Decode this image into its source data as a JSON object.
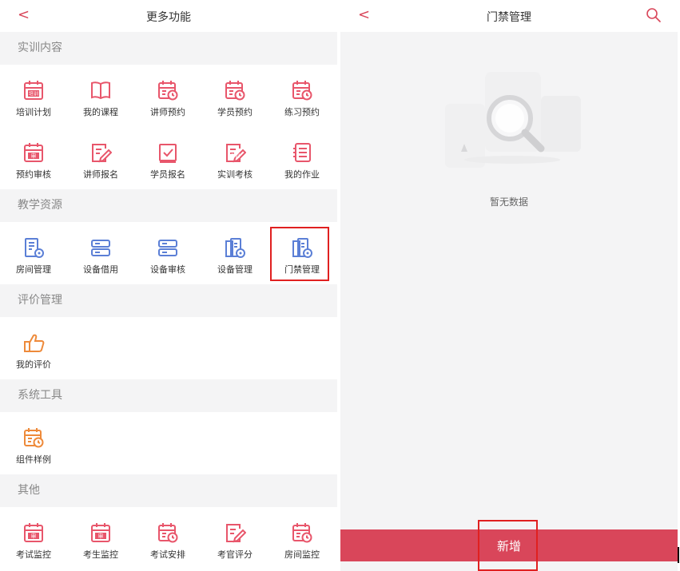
{
  "left": {
    "header": {
      "back": "<",
      "title": "更多功能"
    },
    "sections": [
      {
        "title": "实训内容",
        "items": [
          {
            "label": "培训计划",
            "icon": "training-plan-icon",
            "badge": "培训",
            "color": "#e8566b"
          },
          {
            "label": "我的课程",
            "icon": "book-icon",
            "color": "#e8566b"
          },
          {
            "label": "讲师预约",
            "icon": "calendar-clock-icon",
            "color": "#e8566b"
          },
          {
            "label": "学员预约",
            "icon": "calendar-clock-icon",
            "color": "#e8566b"
          },
          {
            "label": "练习预约",
            "icon": "calendar-clock-icon",
            "color": "#e8566b"
          },
          {
            "label": "预约审核",
            "icon": "calendar-approve-icon",
            "badge": "审",
            "color": "#e8566b"
          },
          {
            "label": "讲师报名",
            "icon": "edit-document-icon",
            "color": "#e8566b"
          },
          {
            "label": "学员报名",
            "icon": "check-box-icon",
            "color": "#e8566b"
          },
          {
            "label": "实训考核",
            "icon": "edit-document-icon",
            "badge": "实训",
            "color": "#e8566b"
          },
          {
            "label": "我的作业",
            "icon": "list-document-icon",
            "color": "#e8566b"
          }
        ]
      },
      {
        "title": "教学资源",
        "items": [
          {
            "label": "房间管理",
            "icon": "building-gear-icon",
            "color": "#5b7fd6"
          },
          {
            "label": "设备借用",
            "icon": "server-icon",
            "color": "#5b7fd6"
          },
          {
            "label": "设备审核",
            "icon": "server-icon",
            "color": "#5b7fd6"
          },
          {
            "label": "设备管理",
            "icon": "door-gear-icon",
            "color": "#5b7fd6"
          },
          {
            "label": "门禁管理",
            "icon": "door-gear-icon",
            "color": "#5b7fd6",
            "highlight": true
          }
        ]
      },
      {
        "title": "评价管理",
        "items": [
          {
            "label": "我的评价",
            "icon": "thumbs-up-icon",
            "color": "#ee8a3a"
          }
        ]
      },
      {
        "title": "系统工具",
        "items": [
          {
            "label": "组件样例",
            "icon": "calendar-clock-icon",
            "color": "#ee8a3a"
          }
        ]
      },
      {
        "title": "其他",
        "items": [
          {
            "label": "考试监控",
            "icon": "calendar-approve-icon",
            "badge": "审",
            "color": "#e8566b"
          },
          {
            "label": "考生监控",
            "icon": "calendar-approve-icon",
            "badge": "审",
            "color": "#e8566b"
          },
          {
            "label": "考试安排",
            "icon": "calendar-clock-icon",
            "color": "#e8566b"
          },
          {
            "label": "考官评分",
            "icon": "edit-document-icon",
            "color": "#e8566b"
          },
          {
            "label": "房间监控",
            "icon": "calendar-clock-icon",
            "color": "#e8566b"
          }
        ]
      }
    ]
  },
  "right": {
    "header": {
      "back": "<",
      "title": "门禁管理",
      "search_icon": "search-icon"
    },
    "empty_text": "暂无数据",
    "add_label": "新增"
  },
  "colors": {
    "accent": "#d9465a",
    "highlight_box": "#e02020",
    "section_bg": "#f4f4f5"
  }
}
